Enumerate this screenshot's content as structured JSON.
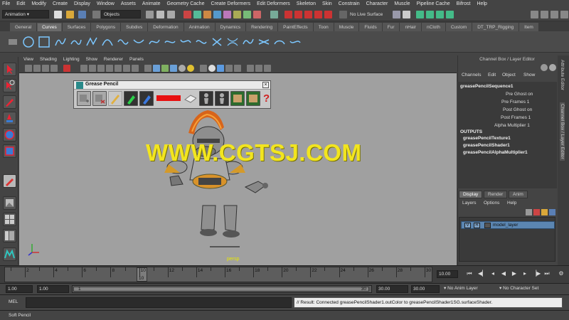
{
  "menu": [
    "File",
    "Edit",
    "Modify",
    "Create",
    "Display",
    "Window",
    "Assets",
    "Animate",
    "Geometry Cache",
    "Create Deformers",
    "Edit Deformers",
    "Skeleton",
    "Skin",
    "Constrain",
    "Character",
    "Muscle",
    "Pipeline Cache",
    "Bifrost",
    "Help"
  ],
  "status_line": {
    "mode_value": "Animation",
    "selection_mask": "Objects",
    "live_surface": "No Live Surface"
  },
  "shelf_tabs": [
    "General",
    "Curves",
    "Surfaces",
    "Polygons",
    "Subdivs",
    "Deformation",
    "Animation",
    "Dynamics",
    "Rendering",
    "PaintEffects",
    "Toon",
    "Muscle",
    "Fluids",
    "Fur",
    "nHair",
    "nCloth",
    "Custom",
    "DT_TRP_Rigging",
    "Item"
  ],
  "shelf_active": "Curves",
  "viewport": {
    "menu": [
      "View",
      "Shading",
      "Lighting",
      "Show",
      "Renderer",
      "Panels"
    ],
    "camera_label": "persp",
    "watermark": "WWW.CGTSJ.COM"
  },
  "grease_pencil": {
    "title": "Grease Pencil",
    "close_glyph": "×"
  },
  "channel_box": {
    "panel_title": "Channel Box / Layer Editor",
    "menu": [
      "Channels",
      "Edit",
      "Object",
      "Show"
    ],
    "node": "greasePencilSequence1",
    "attributes": [
      "Pre Ghost on",
      "Pre Frames 1",
      "Post Ghost on",
      "Post Frames 1",
      "Alpha Multiplier 1"
    ],
    "outputs_header": "OUTPUTS",
    "outputs": [
      "greasePencilTexture1",
      "greasePencilShader1",
      "greasePencilAlphaMultiplier1"
    ]
  },
  "side_tabs": [
    "Attribute Editor",
    "Channel Box / Layer Editor"
  ],
  "layer_editor": {
    "tabs": [
      "Display",
      "Render",
      "Anim"
    ],
    "menu": [
      "Layers",
      "Options",
      "Help"
    ],
    "layer": {
      "v": "V",
      "r": "R",
      "name": "model_layer"
    }
  },
  "time_slider": {
    "ticks": [
      "2",
      "4",
      "6",
      "8",
      "10",
      "12",
      "14",
      "16",
      "18",
      "20",
      "22",
      "24",
      "26",
      "28",
      "30"
    ],
    "current_frame": "10",
    "end_field": "10.00"
  },
  "range_slider": {
    "start": "1.00",
    "playback_start": "1.00",
    "handle_start": "1",
    "handle_end": "30",
    "playback_end": "30.00",
    "end": "30.00",
    "anim_layer": "No Anim Layer",
    "character_set": "No Character Set"
  },
  "command_line": {
    "lang": "MEL",
    "result": "// Result: Connected greasePencilShader1.outColor to greasePencilShader1SG.surfaceShader."
  },
  "help_line": "Soft Pencil",
  "colors": {
    "viewport_bg": "#a0a0a0",
    "watermark": "#f2e51f",
    "layer_highlight": "#5b86b2"
  }
}
